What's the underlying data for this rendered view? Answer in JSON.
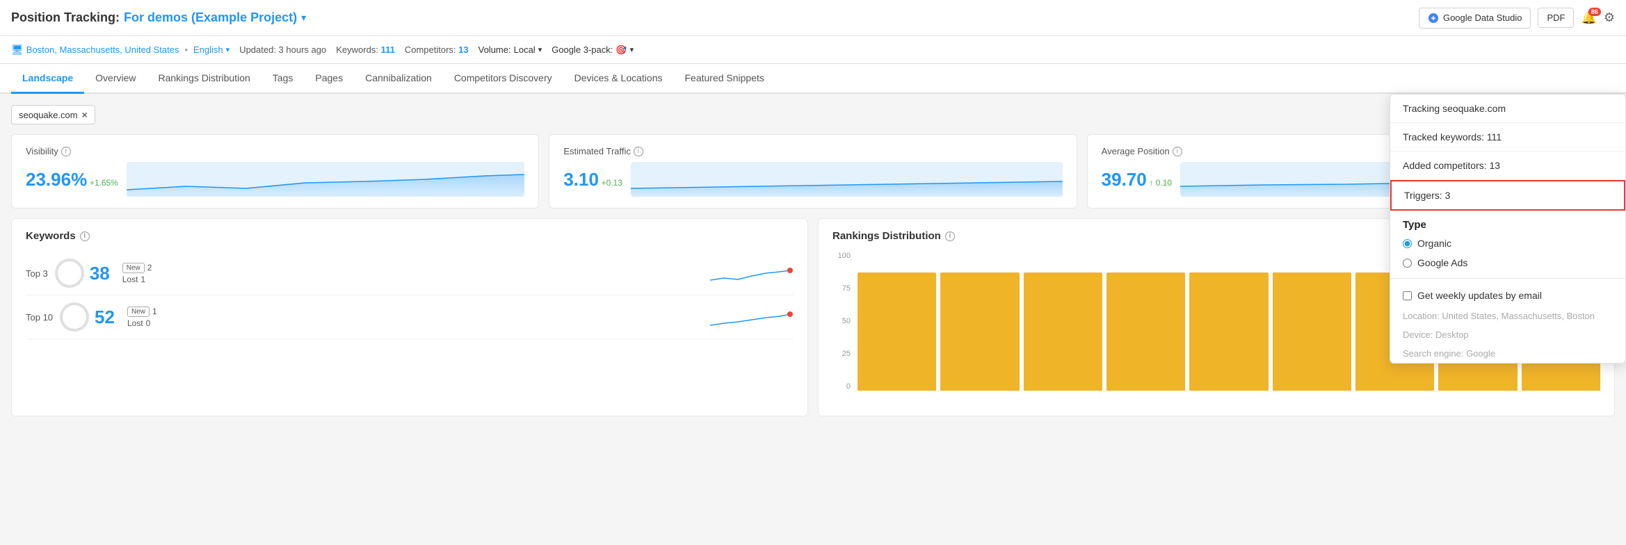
{
  "header": {
    "title_static": "Position Tracking:",
    "title_link": "For demos (Example Project)",
    "title_dropdown_arrow": "▾",
    "gds_button": "Google Data Studio",
    "pdf_button": "PDF",
    "bell_badge": "86",
    "location": "Boston, Massachusetts, United States",
    "language": "English",
    "updated": "Updated: 3 hours ago",
    "keywords_label": "Keywords:",
    "keywords_value": "111",
    "competitors_label": "Competitors:",
    "competitors_value": "13",
    "volume_label": "Volume:",
    "volume_value": "Local",
    "gpack_label": "Google 3-pack:"
  },
  "nav": {
    "items": [
      {
        "label": "Landscape",
        "active": true
      },
      {
        "label": "Overview",
        "active": false
      },
      {
        "label": "Rankings Distribution",
        "active": false
      },
      {
        "label": "Tags",
        "active": false
      },
      {
        "label": "Pages",
        "active": false
      },
      {
        "label": "Cannibalization",
        "active": false
      },
      {
        "label": "Competitors Discovery",
        "active": false
      },
      {
        "label": "Devices & Locations",
        "active": false
      },
      {
        "label": "Featured Snippets",
        "active": false
      }
    ]
  },
  "filter": {
    "tag_label": "seoquake.com",
    "remove_label": "×"
  },
  "cards": {
    "visibility": {
      "title": "Visibility",
      "value": "23.96%",
      "change": "+1.65%"
    },
    "traffic": {
      "title": "Estimated Traffic",
      "value": "3.10",
      "change": "+0.13"
    },
    "position": {
      "title": "Average Position",
      "value": "39.70",
      "change": "↑ 0.10"
    }
  },
  "keywords_section": {
    "title": "Keywords",
    "rows": [
      {
        "label": "Top 3",
        "value": "38",
        "new_label": "New",
        "new_value": "2",
        "lost_label": "Lost",
        "lost_value": "1"
      },
      {
        "label": "Top 10",
        "value": "52",
        "new_label": "New",
        "new_value": "1",
        "lost_label": "Lost",
        "lost_value": "0"
      }
    ]
  },
  "rankings_section": {
    "title": "Rankings Distribution",
    "y_labels": [
      "100",
      "75",
      "50",
      "25",
      "0"
    ],
    "bars": [
      85,
      85,
      85,
      85,
      85,
      85,
      85,
      85,
      85
    ]
  },
  "dropdown": {
    "tracking_label": "Tracking seoquake.com",
    "tracked_keywords": "Tracked keywords: 111",
    "added_competitors": "Added competitors: 13",
    "triggers_label": "Triggers: 3",
    "type_section_title": "Type",
    "type_organic_label": "Organic",
    "type_organic_selected": true,
    "type_google_ads_label": "Google Ads",
    "weekly_updates_label": "Get weekly updates by email",
    "location_label": "Location: United States, Massachusetts, Boston",
    "device_label": "Device: Desktop",
    "search_engine_label": "Search engine: Google"
  }
}
